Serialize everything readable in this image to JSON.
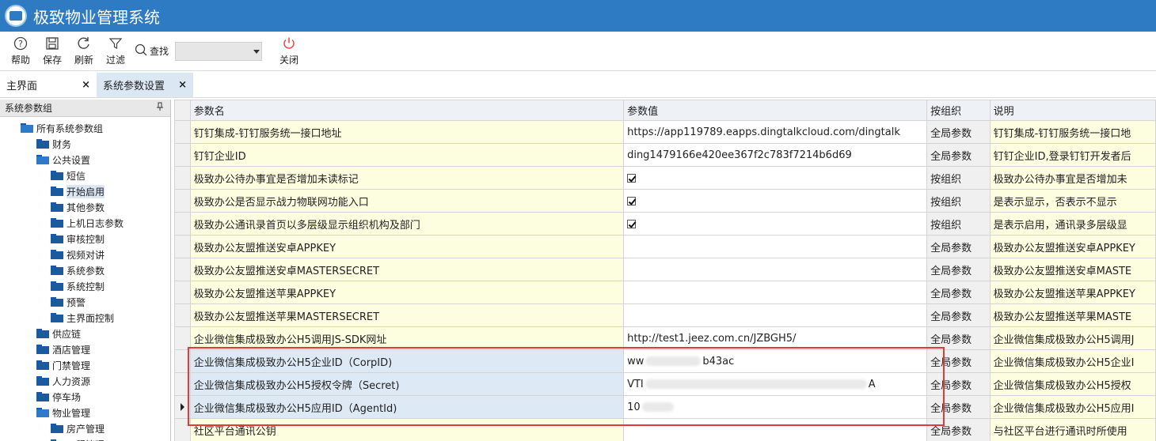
{
  "app": {
    "title": "极致物业管理系统"
  },
  "toolbar": {
    "help": "帮助",
    "save": "保存",
    "refresh": "刷新",
    "filter": "过滤",
    "search_label": "查找",
    "search_value": "",
    "close": "关闭"
  },
  "tabs": [
    {
      "label": "主界面",
      "close": "×"
    },
    {
      "label": "系统参数设置",
      "close": "×"
    }
  ],
  "left_panel": {
    "title": "系统参数组",
    "pin": "ᵖ",
    "tree": [
      {
        "label": "所有系统参数组",
        "level": 1,
        "open": true
      },
      {
        "label": "财务",
        "level": 2
      },
      {
        "label": "公共设置",
        "level": 2,
        "open": true
      },
      {
        "label": "短信",
        "level": 3
      },
      {
        "label": "开始启用",
        "level": 3,
        "selected": true
      },
      {
        "label": "其他参数",
        "level": 3
      },
      {
        "label": "上机日志参数",
        "level": 3
      },
      {
        "label": "审核控制",
        "level": 3
      },
      {
        "label": "视频对讲",
        "level": 3
      },
      {
        "label": "系统参数",
        "level": 3
      },
      {
        "label": "系统控制",
        "level": 3
      },
      {
        "label": "预警",
        "level": 3
      },
      {
        "label": "主界面控制",
        "level": 3
      },
      {
        "label": "供应链",
        "level": 2
      },
      {
        "label": "酒店管理",
        "level": 2
      },
      {
        "label": "门禁管理",
        "level": 2
      },
      {
        "label": "人力资源",
        "level": 2
      },
      {
        "label": "停车场",
        "level": 2
      },
      {
        "label": "物业管理",
        "level": 2,
        "open": true
      },
      {
        "label": "房产管理",
        "level": 3
      },
      {
        "label": "工程管理",
        "level": 3
      }
    ]
  },
  "grid": {
    "columns": [
      "参数名",
      "参数值",
      "按组织",
      "说明"
    ],
    "rows": [
      {
        "name": "钉钉集成-钉钉服务统一接口地址",
        "value": "https://app119789.eapps.dingtalkcloud.com/dingtalk",
        "org": "全局参数",
        "desc": "钉钉集成-钉钉服务统一接口地"
      },
      {
        "name": "钉钉企业ID",
        "value": "ding1479166e420ee367f2c783f7214b6d69",
        "org": "全局参数",
        "desc": "钉钉企业ID,登录钉钉开发者后"
      },
      {
        "name": "极致办公待办事宜是否增加未读标记",
        "value": "",
        "checkbox": true,
        "org": "按组织",
        "desc": "极致办公待办事宜是否增加未"
      },
      {
        "name": "极致办公是否显示战力物联网功能入口",
        "value": "",
        "checkbox": true,
        "org": "按组织",
        "desc": "是表示显示，否表示不显示"
      },
      {
        "name": "极致办公通讯录首页以多层级显示组织机构及部门",
        "value": "",
        "checkbox": true,
        "org": "按组织",
        "desc": "是表示启用，通讯录多层级显"
      },
      {
        "name": "极致办公友盟推送安卓APPKEY",
        "value": "",
        "org": "全局参数",
        "desc": "极致办公友盟推送安卓APPKEY"
      },
      {
        "name": "极致办公友盟推送安卓MASTERSECRET",
        "value": "",
        "org": "全局参数",
        "desc": "极致办公友盟推送安卓MASTE"
      },
      {
        "name": "极致办公友盟推送苹果APPKEY",
        "value": "",
        "org": "全局参数",
        "desc": "极致办公友盟推送苹果APPKEY"
      },
      {
        "name": "极致办公友盟推送苹果MASTERSECRET",
        "value": "",
        "org": "全局参数",
        "desc": "极致办公友盟推送苹果MASTE"
      },
      {
        "name": "企业微信集成极致办公H5调用JS-SDK网址",
        "value": "http://test1.jeez.com.cn/JZBGH5/",
        "org": "全局参数",
        "desc": "企业微信集成极致办公H5调用J"
      },
      {
        "name": "企业微信集成极致办公H5企业ID（CorpID)",
        "value_a": "ww",
        "value_b": "b43ac",
        "org": "全局参数",
        "desc": "企业微信集成极致办公H5企业I",
        "highlight": true
      },
      {
        "name": "企业微信集成极致办公H5授权令牌（Secret)",
        "value_a": "VTI",
        "value_b": "A",
        "org": "全局参数",
        "desc": "企业微信集成极致办公H5授权",
        "highlight": true
      },
      {
        "name": "企业微信集成极致办公H5应用ID（AgentId)",
        "value_a": "10",
        "value_b": "",
        "org": "全局参数",
        "desc": "企业微信集成极致办公H5应用I",
        "highlight": true,
        "current": true
      },
      {
        "name": "社区平台通讯公钥",
        "value": "",
        "org": "全局参数",
        "desc": "与社区平台进行通讯时所使用"
      }
    ]
  },
  "colors": {
    "titlebar": "#2e7bc4",
    "selection": "#dbe7f3",
    "highlight_box": "#e03a3a"
  }
}
